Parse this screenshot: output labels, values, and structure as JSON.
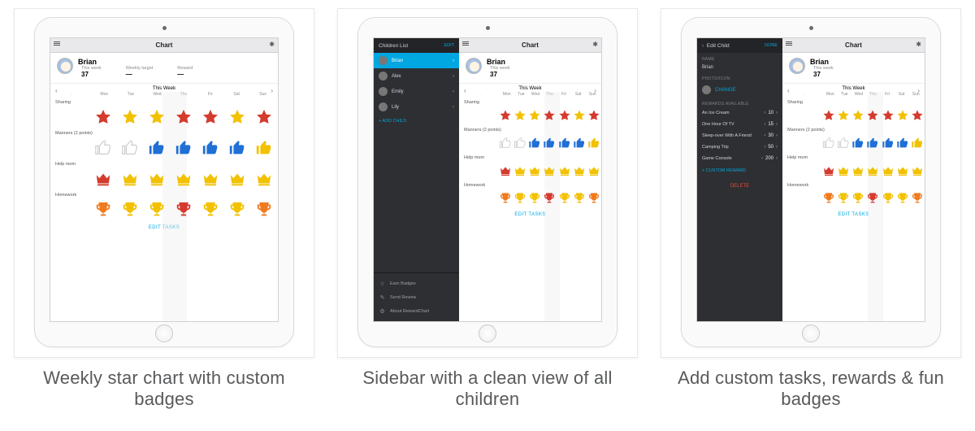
{
  "captions": {
    "c1": "Weekly star chart with custom badges",
    "c2": "Sidebar with a clean view of all children",
    "c3": "Add custom tasks, rewards & fun badges"
  },
  "chart": {
    "nav_title": "Chart",
    "child_name": "Brian",
    "stats": [
      {
        "label": "This week",
        "value": "37"
      },
      {
        "label": "Weekly target",
        "value": "—"
      },
      {
        "label": "Reward",
        "value": "—"
      }
    ],
    "week_label": "This Week",
    "days": [
      "Mon",
      "Tue",
      "Wed",
      "Thu",
      "Fri",
      "Sat",
      "Sun"
    ],
    "today_index": 3,
    "rows": [
      {
        "label": "Sharing",
        "shape": "star",
        "colors": [
          "red",
          "gold",
          "gold",
          "red",
          "red",
          "gold",
          "red"
        ]
      },
      {
        "label": "Manners (2 points)",
        "shape": "thumb",
        "colors": [
          "empty",
          "empty",
          "blue",
          "blue",
          "blue",
          "blue",
          "gold"
        ]
      },
      {
        "label": "Help mom",
        "shape": "crown",
        "colors": [
          "red",
          "gold",
          "gold",
          "gold",
          "gold",
          "gold",
          "gold"
        ]
      },
      {
        "label": "Homework",
        "shape": "trophy",
        "colors": [
          "orange",
          "gold",
          "gold",
          "red",
          "gold",
          "gold",
          "orange"
        ]
      }
    ],
    "footer_link": "EDIT TASKS"
  },
  "sidebar_children": {
    "title": "Children List",
    "edit_label": "EDIT",
    "items": [
      {
        "name": "Brian",
        "selected": true
      },
      {
        "name": "Alex",
        "selected": false
      },
      {
        "name": "Emily",
        "selected": false
      },
      {
        "name": "Lily",
        "selected": false
      }
    ],
    "add_label": "+ ADD CHILD",
    "footer": [
      {
        "icon": "☆",
        "label": "Earn Badges"
      },
      {
        "icon": "✎",
        "label": "Send Review"
      },
      {
        "icon": "⚙",
        "label": "About RewardChart"
      }
    ]
  },
  "sidebar_edit": {
    "back": "‹",
    "title": "Edit Child",
    "done": "DONE",
    "section_name": "NAME",
    "name_value": "Brian",
    "section_photo": "PHOTO/ICON",
    "photo_action": "CHANGE",
    "section_rewards": "REWARDS AVAILABLE",
    "rewards": [
      {
        "label": "An Ice Cream",
        "pts": "10"
      },
      {
        "label": "One Hour Of TV",
        "pts": "15"
      },
      {
        "label": "Sleep-over With A Friend",
        "pts": "30"
      },
      {
        "label": "Camping Trip",
        "pts": "50"
      },
      {
        "label": "Game Console",
        "pts": "200"
      }
    ],
    "add_reward": "+ CUSTOM REWARD",
    "delete": "DELETE"
  }
}
